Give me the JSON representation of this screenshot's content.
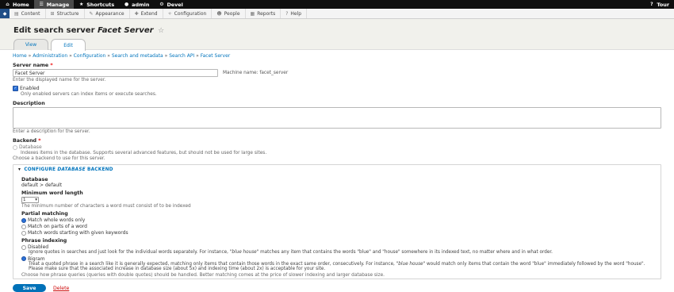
{
  "toolbar": {
    "home": "Home",
    "manage": "Manage",
    "shortcuts": "Shortcuts",
    "user": "admin",
    "devel": "Devel",
    "tour": "Tour"
  },
  "tray": {
    "items": [
      "Content",
      "Structure",
      "Appearance",
      "Extend",
      "Configuration",
      "People",
      "Reports",
      "Help"
    ]
  },
  "header": {
    "title_prefix": "Edit search server",
    "title_name": "Facet Server",
    "star": "☆",
    "tabs": [
      "View",
      "Edit"
    ],
    "active_tab": "Edit"
  },
  "breadcrumb": {
    "items": [
      "Home",
      "Administration",
      "Configuration",
      "Search and metadata",
      "Search API",
      "Facet Server"
    ],
    "separator": "»"
  },
  "form": {
    "server_name_label": "Server name",
    "required_mark": "*",
    "server_name_value": "Facet Server",
    "machine_name": "Machine name: facet_server",
    "server_name_desc": "Enter the displayed name for the server.",
    "enabled_label": "Enabled",
    "enabled_desc": "Only enabled servers can index items or execute searches.",
    "description_label": "Description",
    "description_desc": "Enter a description for the server.",
    "backend_label": "Backend",
    "backend_option": "Database",
    "backend_option_desc": "Indexes items in the database. Supports several advanced features, but should not be used for large sites.",
    "backend_desc": "Choose a backend to use for this server."
  },
  "backend_config": {
    "legend_prefix": "CONFIGURE",
    "legend_em": "DATABASE",
    "legend_suffix": "BACKEND",
    "database_label": "Database",
    "database_value": "default > default",
    "min_word_label": "Minimum word length",
    "min_word_value": "1",
    "min_word_desc": "The minimum number of characters a word must consist of to be indexed",
    "partial_label": "Partial matching",
    "partial_options": [
      "Match whole words only",
      "Match on parts of a word",
      "Match words starting with given keywords"
    ],
    "partial_selected": 0,
    "phrase_label": "Phrase indexing",
    "phrase_disabled": "Disabled",
    "phrase_disabled_desc_a": "Ignore quotes in searches and just look for the individual words separately. For instance, ",
    "phrase_disabled_desc_em": "\"blue house\"",
    "phrase_disabled_desc_b": " matches any item that contains the words \"blue\" and \"house\" somewhere in its indexed text, no matter where and in what order.",
    "phrase_bigram": "Bigram",
    "phrase_bigram_desc_a": "Treat a quoted phrase in a search like it is generally expected, matching only items that contain those words in the exact same order, consecutively. For instance, ",
    "phrase_bigram_desc_em": "\"blue house\"",
    "phrase_bigram_desc_b": " would match only items that contain the word \"blue\" immediately followed by the word \"house\". Please make sure that the associated increase in database size (about 5x) and indexing time (about 2x) is acceptable for your site.",
    "phrase_selected": 1,
    "phrase_desc": "Choose how phrase queries (queries with double quotes) should be handled. Better matching comes at the price of slower indexing and larger database size."
  },
  "actions": {
    "save": "Save",
    "delete": "Delete"
  }
}
